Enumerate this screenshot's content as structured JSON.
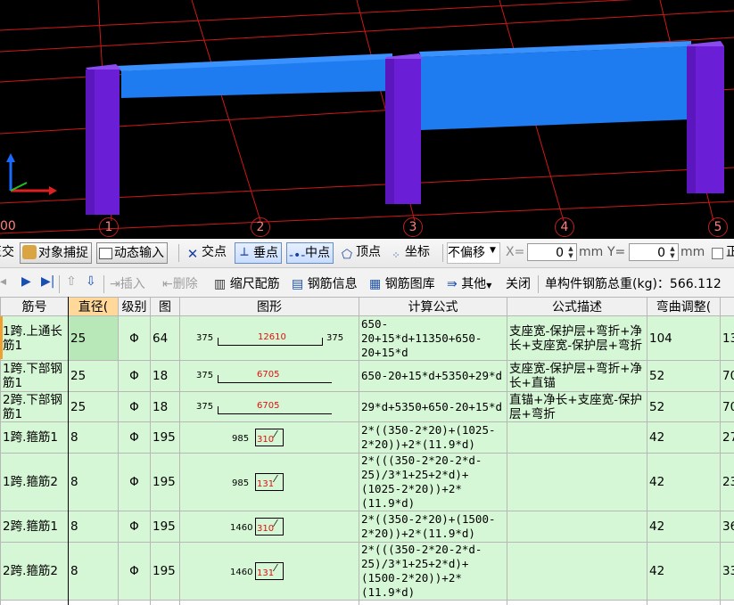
{
  "viewport": {
    "axis_numbers": [
      "1",
      "2",
      "3",
      "4",
      "5"
    ],
    "left_label": "00"
  },
  "snap_toolbar": {
    "cut_label": "正交",
    "object_snap": "对象捕捉",
    "dynamic_input": "动态输入",
    "intersection": "交点",
    "perpendicular": "垂点",
    "midpoint": "中点",
    "vertex": "顶点",
    "coordinate": "坐标",
    "offset_select": "不偏移",
    "x_label": "X=",
    "x_value": "0",
    "x_unit": "mm",
    "y_label": "Y=",
    "y_value": "0",
    "y_unit": "mm"
  },
  "table_toolbar": {
    "insert": "插入",
    "delete": "删除",
    "scale_rebar": "缩尺配筋",
    "rebar_info": "钢筋信息",
    "rebar_library": "钢筋图库",
    "other": "其他",
    "close": "关闭",
    "total_weight": "单构件钢筋总重(kg)：566.112"
  },
  "table": {
    "headers": [
      "筋号",
      "直径(",
      "级别",
      "图",
      "图形",
      "计算公式",
      "公式描述",
      "弯曲调整(",
      "长"
    ],
    "rows": [
      {
        "name": "1跨.上通长筋1",
        "dia": "25",
        "grade": "Φ",
        "fig": "64",
        "shape": {
          "left": "375",
          "mid": "12610",
          "right": "375"
        },
        "formula": "650-20+15*d+11350+650-20+15*d",
        "desc": "支座宽-保护层+弯折+净长+支座宽-保护层+弯折",
        "bend": "104",
        "len": "13"
      },
      {
        "name": "1跨.下部钢筋1",
        "dia": "25",
        "grade": "Φ",
        "fig": "18",
        "shape": {
          "left": "375",
          "mid": "6705",
          "right": ""
        },
        "formula": "650-20+15*d+5350+29*d",
        "desc": "支座宽-保护层+弯折+净长+直锚",
        "bend": "52",
        "len": "70"
      },
      {
        "name": "2跨.下部钢筋1",
        "dia": "25",
        "grade": "Φ",
        "fig": "18",
        "shape": {
          "left": "375",
          "mid": "6705",
          "right": ""
        },
        "formula": "29*d+5350+650-20+15*d",
        "desc": "直锚+净长+支座宽-保护层+弯折",
        "bend": "52",
        "len": "70"
      },
      {
        "name": "1跨.箍筋1",
        "dia": "8",
        "grade": "Φ",
        "fig": "195",
        "shape": {
          "left": "985",
          "mid": "310",
          "right": ""
        },
        "formula": "2*((350-2*20)+(1025-2*20))+2*(11.9*d)",
        "desc": "",
        "bend": "42",
        "len": "27"
      },
      {
        "name": "1跨.箍筋2",
        "dia": "8",
        "grade": "Φ",
        "fig": "195",
        "shape": {
          "left": "985",
          "mid": "131",
          "right": ""
        },
        "formula": "2*(((350-2*20-2*d-25)/3*1+25+2*d)+(1025-2*20))+2*(11.9*d)",
        "desc": "",
        "bend": "42",
        "len": "23"
      },
      {
        "name": "2跨.箍筋1",
        "dia": "8",
        "grade": "Φ",
        "fig": "195",
        "shape": {
          "left": "1460",
          "mid": "310",
          "right": ""
        },
        "formula": "2*((350-2*20)+(1500-2*20))+2*(11.9*d)",
        "desc": "",
        "bend": "42",
        "len": "36"
      },
      {
        "name": "2跨.箍筋2",
        "dia": "8",
        "grade": "Φ",
        "fig": "195",
        "shape": {
          "left": "1460",
          "mid": "131",
          "right": ""
        },
        "formula": "2*(((350-2*20-2*d-25)/3*1+25+2*d)+(1500-2*20))+2*(11.9*d)",
        "desc": "",
        "bend": "42",
        "len": "33"
      }
    ]
  },
  "colors": {
    "beam": "#1e7cf0",
    "column": "#6a1fd6",
    "grid_line": "#d01818",
    "row_bg": "#d6f7d6",
    "selected_header": "#ffd89a"
  }
}
